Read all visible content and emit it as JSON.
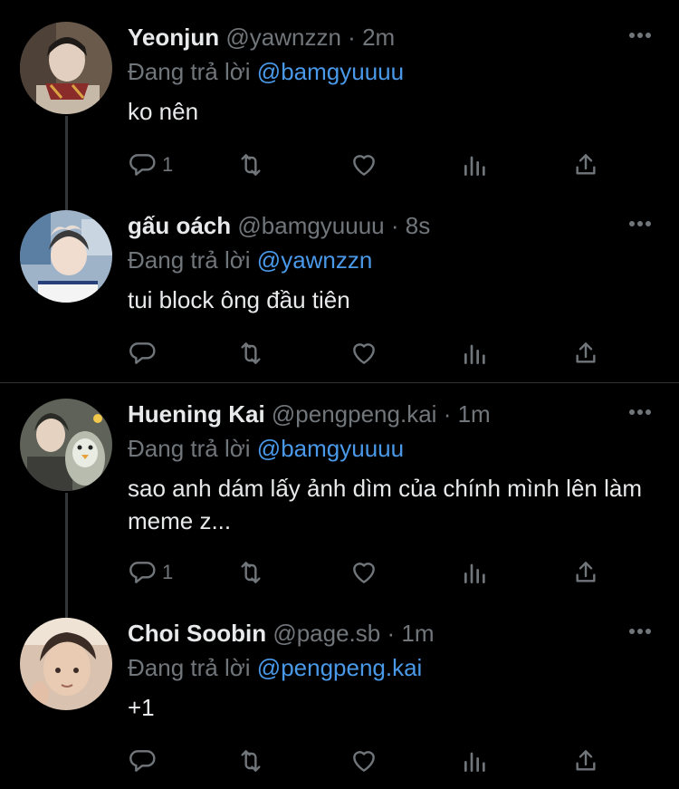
{
  "tweets": [
    {
      "name": "Yeonjun",
      "handle": "@yawnzzn",
      "dot": "·",
      "time": "2m",
      "replying_prefix": "Đang trả lời",
      "replying_to": "@bamgyuuuu",
      "text": "ko nên",
      "reply_count": "1",
      "avatar_colors": [
        "#6a5a4c",
        "#c7b9a8",
        "#8a2c2a"
      ]
    },
    {
      "name": "gấu oách",
      "handle": "@bamgyuuuu",
      "dot": "·",
      "time": "8s",
      "replying_prefix": "Đang trả lời",
      "replying_to": "@yawnzzn",
      "text": "tui block ông đầu tiên",
      "reply_count": "",
      "avatar_colors": [
        "#9fb3c8",
        "#e8ddd4",
        "#3a3a3a"
      ]
    },
    {
      "name": "Huening Kai",
      "handle": "@pengpeng.kai",
      "dot": "·",
      "time": "1m",
      "replying_prefix": "Đang trả lời",
      "replying_to": "@bamgyuuuu",
      "text": "sao anh dám lấy ảnh dìm của chính mình lên làm meme z...",
      "reply_count": "1",
      "avatar_colors": [
        "#5f6258",
        "#b8bcae",
        "#2a2a26"
      ]
    },
    {
      "name": "Choi Soobin",
      "handle": "@page.sb",
      "dot": "·",
      "time": "1m",
      "replying_prefix": "Đang trả lời",
      "replying_to": "@pengpeng.kai",
      "text": "+1",
      "reply_count": "",
      "avatar_colors": [
        "#d9c3b0",
        "#3b2c25",
        "#efe3d6"
      ]
    }
  ],
  "icons": [
    "reply-icon",
    "retweet-icon",
    "like-icon",
    "analytics-icon",
    "share-icon",
    "more-icon"
  ],
  "colors": {
    "background": "#000000",
    "text": "#e7e9ea",
    "muted": "#71767b",
    "mention": "#4a99e9"
  }
}
